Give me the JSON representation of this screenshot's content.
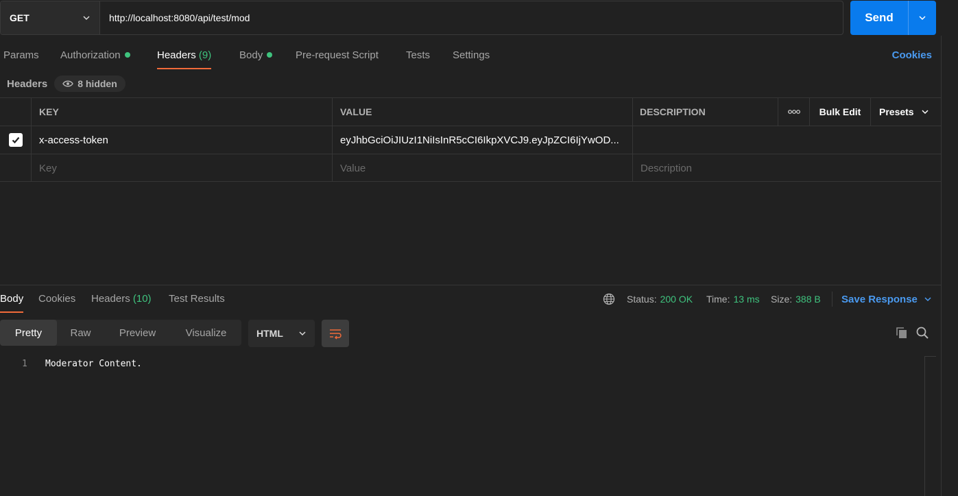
{
  "request": {
    "method": "GET",
    "url": "http://localhost:8080/api/test/mod",
    "send_label": "Send"
  },
  "request_tabs": {
    "params": "Params",
    "authorization": "Authorization",
    "headers": "Headers",
    "headers_count": "(9)",
    "body": "Body",
    "prerequest": "Pre-request Script",
    "tests": "Tests",
    "settings": "Settings",
    "cookies": "Cookies"
  },
  "headers_section": {
    "label": "Headers",
    "hidden": "8 hidden"
  },
  "table": {
    "columns": {
      "key": "KEY",
      "value": "VALUE",
      "description": "DESCRIPTION",
      "more": "ooo",
      "bulk_edit": "Bulk Edit",
      "presets": "Presets"
    },
    "rows": [
      {
        "checked": true,
        "key": "x-access-token",
        "value": "eyJhbGciOiJIUzI1NiIsInR5cCI6IkpXVCJ9.eyJpZCI6IjYwOD...",
        "description": ""
      }
    ],
    "placeholders": {
      "key": "Key",
      "value": "Value",
      "description": "Description"
    }
  },
  "response": {
    "tabs": {
      "body": "Body",
      "cookies": "Cookies",
      "headers": "Headers",
      "headers_count": "(10)",
      "test_results": "Test Results"
    },
    "status_label": "Status:",
    "status": "200 OK",
    "time_label": "Time:",
    "time": "13 ms",
    "size_label": "Size:",
    "size": "388 B",
    "save_response": "Save Response",
    "views": [
      "Pretty",
      "Raw",
      "Preview",
      "Visualize"
    ],
    "format": "HTML",
    "lines": [
      {
        "number": "1",
        "text": "Moderator Content."
      }
    ]
  },
  "colors": {
    "accent_orange": "#f26b3a",
    "send_blue": "#097bed",
    "link_blue": "#4a9af0",
    "success_green": "#3fc37e",
    "background": "#212121"
  },
  "icons": [
    "chevron-down-icon",
    "eye-icon",
    "checkmark-icon",
    "globe-icon",
    "wrap-lines-icon",
    "copy-icon",
    "search-icon"
  ]
}
